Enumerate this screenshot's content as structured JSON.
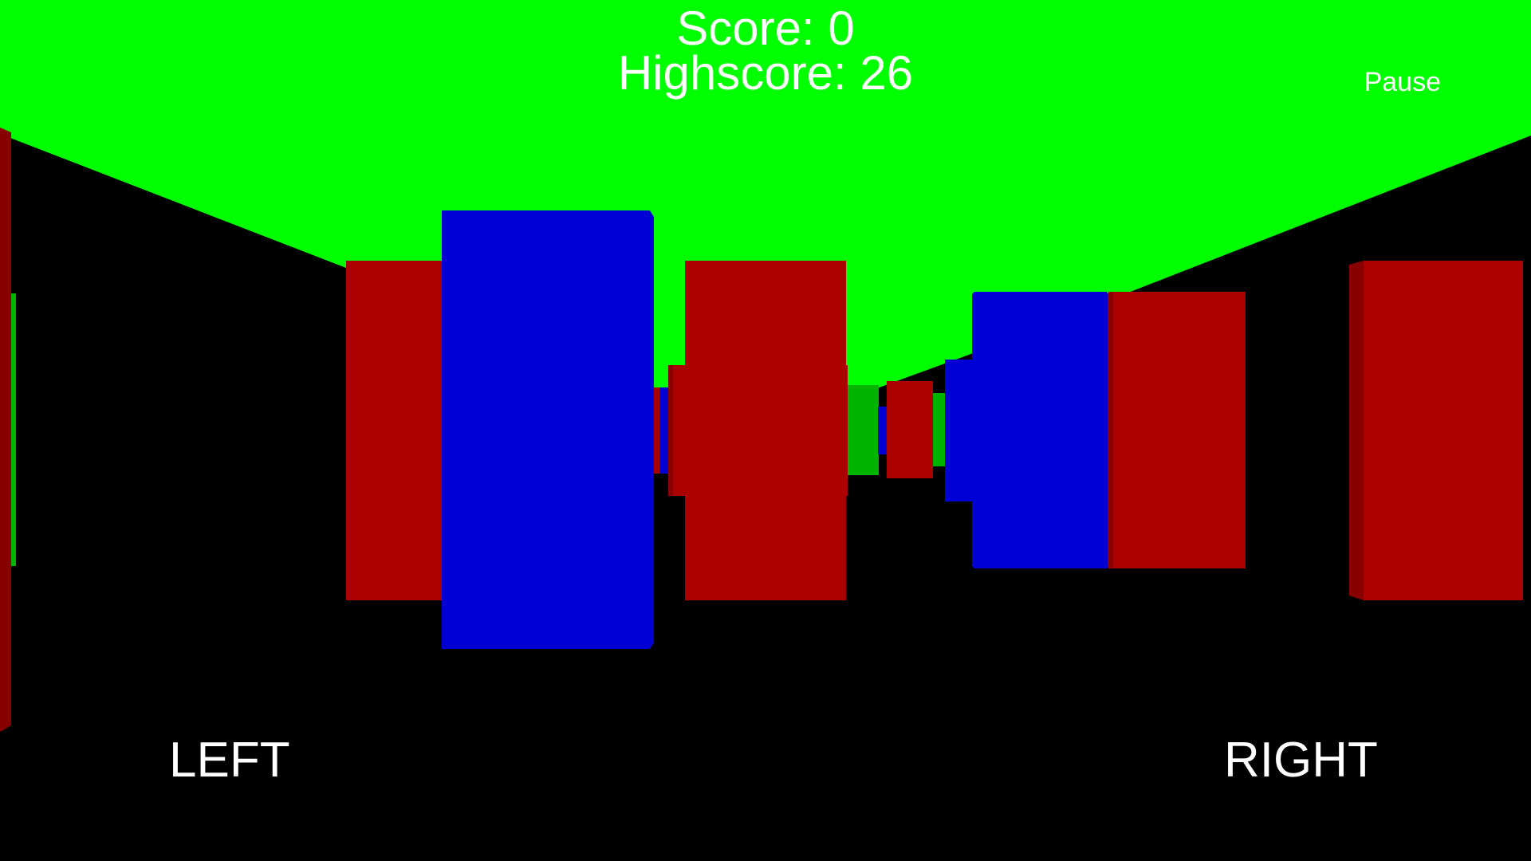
{
  "hud": {
    "score_text": "Score: 0",
    "highscore_text": "Highscore: 26",
    "pause_label": "Pause"
  },
  "controls": {
    "left_label": "LEFT",
    "right_label": "RIGHT"
  },
  "colors": {
    "sky": "#00ff00",
    "ground": "#000000",
    "red_block": "#aa0000",
    "red_block_side": "#880000",
    "blue_block": "#0000d4",
    "green_block": "#00b400",
    "text": "#ffffff"
  }
}
